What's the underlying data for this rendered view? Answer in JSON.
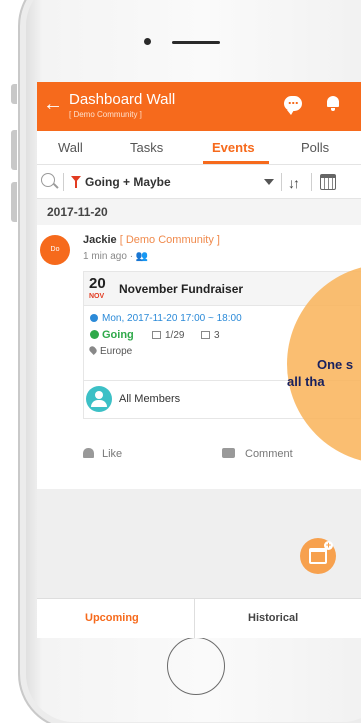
{
  "colors": {
    "brand": "#f66a1c",
    "accent_blue": "#2b8ad8",
    "going_green": "#2fa94a",
    "overlay": "#f9b358"
  },
  "topbar": {
    "back_icon": "arrow-left-icon",
    "title": "Dashboard Wall",
    "subtitle": "[ Demo Community ]",
    "chat_icon": "chat-icon",
    "bell_icon": "bell-icon"
  },
  "tabs": [
    {
      "label": "Wall"
    },
    {
      "label": "Tasks"
    },
    {
      "label": "Events",
      "active": true
    },
    {
      "label": "Polls"
    }
  ],
  "filter": {
    "search_icon": "search-icon",
    "filter_icon": "funnel-icon",
    "label": "Going + Maybe",
    "sort_icon": "sort-icon",
    "calendar_icon": "calendar-icon"
  },
  "feed": {
    "date": "2017-11-20",
    "post": {
      "avatar_text": "Do",
      "author": "Jackie",
      "community": "[ Demo Community ]",
      "meta": "1 min ago · 👥",
      "event": {
        "day": "20",
        "month": "NOV",
        "title": "November Fundraiser",
        "time": "Mon, 2017-11-20 17:00 ~ 18:00",
        "status": "Going",
        "attendance": "1/29",
        "photos": "3",
        "location": "Europe"
      },
      "audience": "All Members",
      "like_label": "Like",
      "comment_label": "Comment"
    }
  },
  "fab": {
    "icon": "add-event-icon"
  },
  "bottom_tabs": [
    {
      "label": "Upcoming",
      "active": true
    },
    {
      "label": "Historical"
    }
  ],
  "overlay": {
    "line1": "One s",
    "line2": "all tha"
  }
}
